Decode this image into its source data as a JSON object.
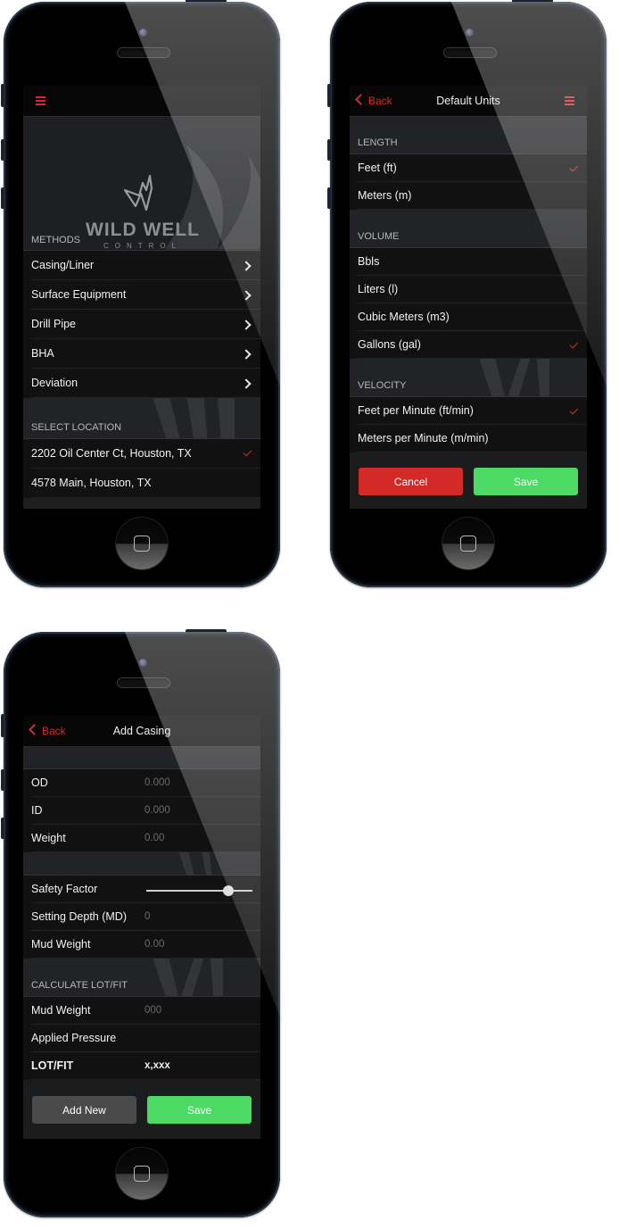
{
  "colors": {
    "accent_red": "#d42a2a",
    "save_green": "#4cd964",
    "cancel_red": "#d32a27",
    "neutral_button": "#4a4a4a",
    "row_bg": "#111112",
    "section_bg": "#222326"
  },
  "phone1": {
    "menu_icon": "hamburger-icon",
    "logo": {
      "name": "WILD WELL",
      "subtitle": "CONTROL"
    },
    "methods_header": "METHODS",
    "methods": [
      {
        "label": "Casing/Liner",
        "icon": "chevron-right-icon"
      },
      {
        "label": "Surface Equipment",
        "icon": "chevron-right-icon"
      },
      {
        "label": "Drill Pipe",
        "icon": "chevron-right-icon"
      },
      {
        "label": "BHA",
        "icon": "chevron-right-icon"
      },
      {
        "label": "Deviation",
        "icon": "chevron-right-icon"
      }
    ],
    "location_header": "SELECT LOCATION",
    "locations": [
      {
        "label": "2202 Oil Center Ct, Houston, TX",
        "selected": true
      },
      {
        "label": "4578 Main, Houston, TX",
        "selected": false
      }
    ]
  },
  "phone2": {
    "back_label": "Back",
    "title": "Default Units",
    "menu_icon": "hamburger-icon",
    "sections": [
      {
        "header": "LENGTH",
        "options": [
          {
            "label": "Feet (ft)",
            "selected": true
          },
          {
            "label": "Meters (m)",
            "selected": false
          }
        ]
      },
      {
        "header": "VOLUME",
        "options": [
          {
            "label": "Bbls",
            "selected": false
          },
          {
            "label": "Liters (l)",
            "selected": false
          },
          {
            "label": "Cubic Meters (m3)",
            "selected": false
          },
          {
            "label": "Gallons (gal)",
            "selected": true
          }
        ]
      },
      {
        "header": "VELOCITY",
        "options": [
          {
            "label": "Feet per Minute (ft/min)",
            "selected": true
          },
          {
            "label": "Meters per Minute (m/min)",
            "selected": false
          }
        ]
      }
    ],
    "cancel_label": "Cancel",
    "save_label": "Save"
  },
  "phone3": {
    "back_label": "Back",
    "title": "Add Casing",
    "fields1": [
      {
        "label": "OD",
        "placeholder": "0.000"
      },
      {
        "label": "ID",
        "placeholder": "0.000"
      },
      {
        "label": "Weight",
        "placeholder": "0.00"
      }
    ],
    "safety_factor": {
      "label": "Safety Factor",
      "value_fraction": 0.77
    },
    "fields2": [
      {
        "label": "Setting Depth (MD)",
        "placeholder": "0"
      },
      {
        "label": "Mud Weight",
        "placeholder": "0.00"
      }
    ],
    "lot_header": "CALCULATE LOT/FIT",
    "lot_fields": [
      {
        "label": "Mud Weight",
        "placeholder": "000"
      },
      {
        "label": "Applied Pressure",
        "placeholder": ""
      }
    ],
    "lot_result": {
      "label": "LOT/FIT",
      "value": "x,xxx"
    },
    "add_new_label": "Add New",
    "save_label": "Save"
  }
}
